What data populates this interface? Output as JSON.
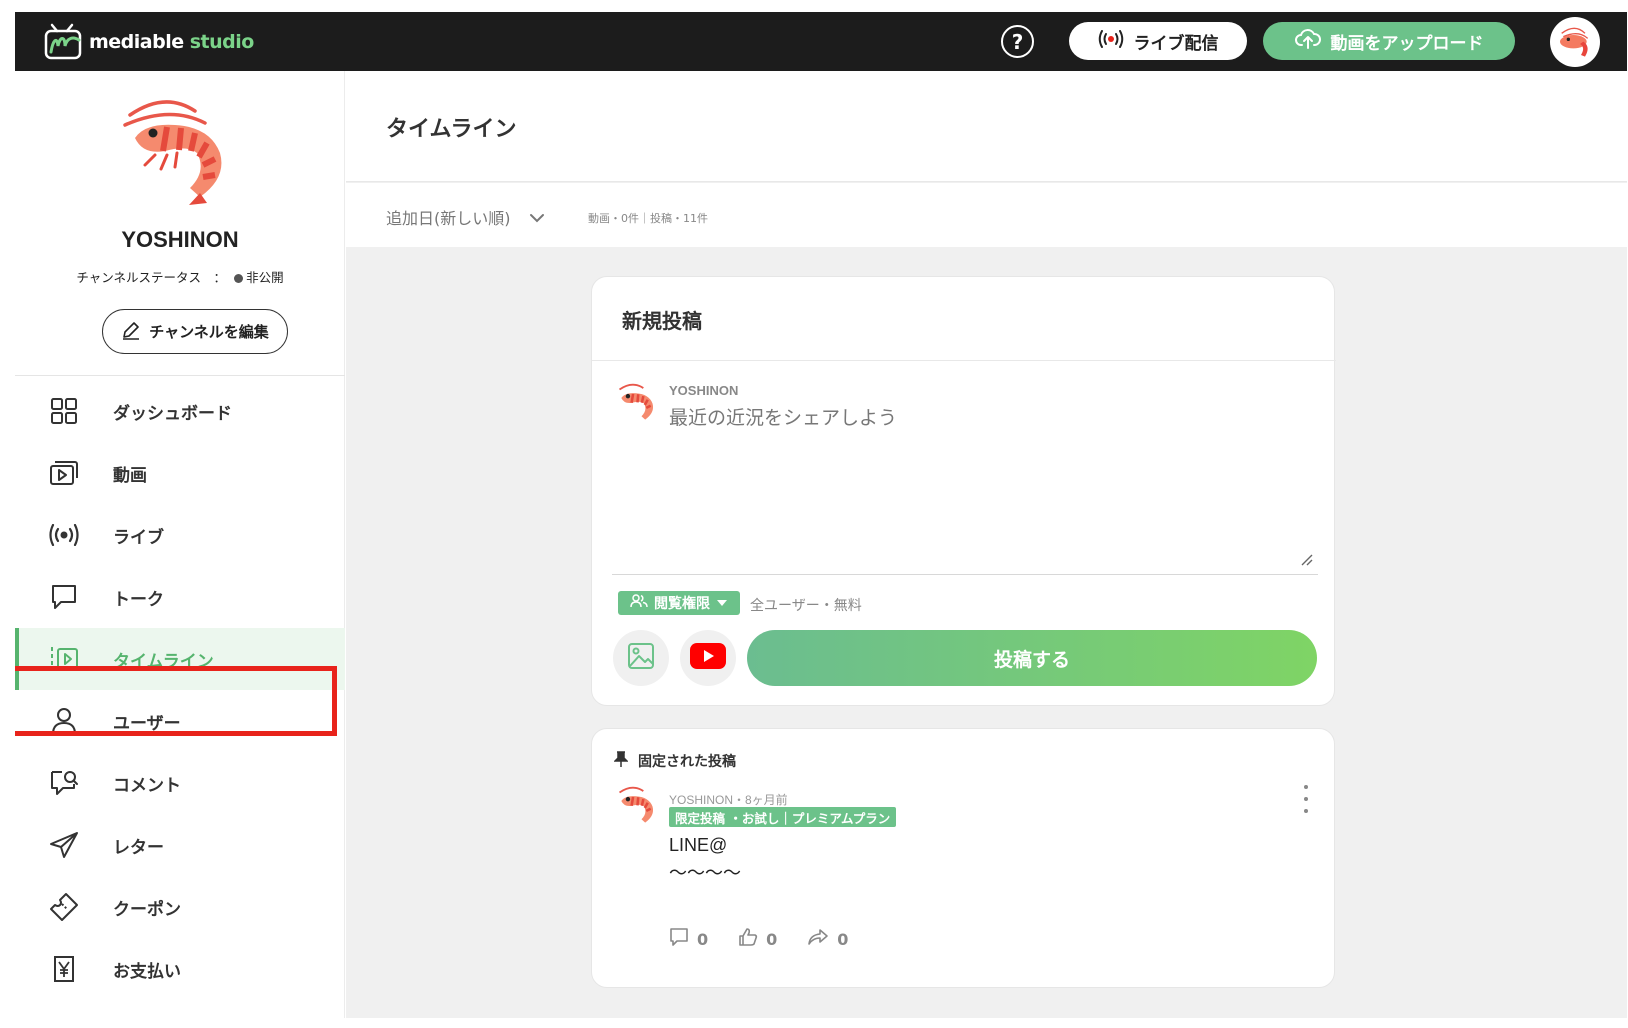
{
  "app": {
    "logo_main": "mediable",
    "logo_sub": " studio"
  },
  "topbar": {
    "help_glyph": "?",
    "live_label": "ライブ配信",
    "upload_label": "動画をアップロード"
  },
  "sidebar": {
    "channel_name": "YOSHINON",
    "status_label": "チャンネルステータス　：",
    "status_value": "非公開",
    "edit_label": "チャンネルを編集",
    "items": [
      {
        "label": "ダッシュボード",
        "icon": "grid-icon"
      },
      {
        "label": "動画",
        "icon": "video-icon"
      },
      {
        "label": "ライブ",
        "icon": "broadcast-icon"
      },
      {
        "label": "トーク",
        "icon": "chat-icon"
      },
      {
        "label": "タイムライン",
        "icon": "timeline-icon",
        "active": true
      },
      {
        "label": "ユーザー",
        "icon": "user-icon"
      },
      {
        "label": "コメント",
        "icon": "comment-icon"
      },
      {
        "label": "レター",
        "icon": "send-icon"
      },
      {
        "label": "クーポン",
        "icon": "ticket-icon"
      },
      {
        "label": "お支払い",
        "icon": "yen-icon"
      }
    ]
  },
  "main": {
    "page_title": "タイムライン",
    "sort_label": "追加日(新しい順)",
    "counts": "動画・0件｜投稿・11件"
  },
  "new_post": {
    "title": "新規投稿",
    "user": "YOSHINON",
    "placeholder": "最近の近況をシェアしよう",
    "permission_label": "閲覧権限",
    "permission_value": "全ユーザー・無料",
    "submit_label": "投稿する"
  },
  "pinned_post": {
    "label": "固定された投稿",
    "meta": "YOSHINON・8ヶ月前",
    "badge": "限定投稿 ・お試し｜プレミアムプラン",
    "line1": "LINE@",
    "line2": "〜〜〜〜",
    "comments": "0",
    "likes": "0",
    "shares": "0"
  },
  "colors": {
    "accent_green": "#6cc28a",
    "active_green": "#56b46e",
    "highlight_red": "#e8231b",
    "topbar": "#1c1c1c"
  }
}
